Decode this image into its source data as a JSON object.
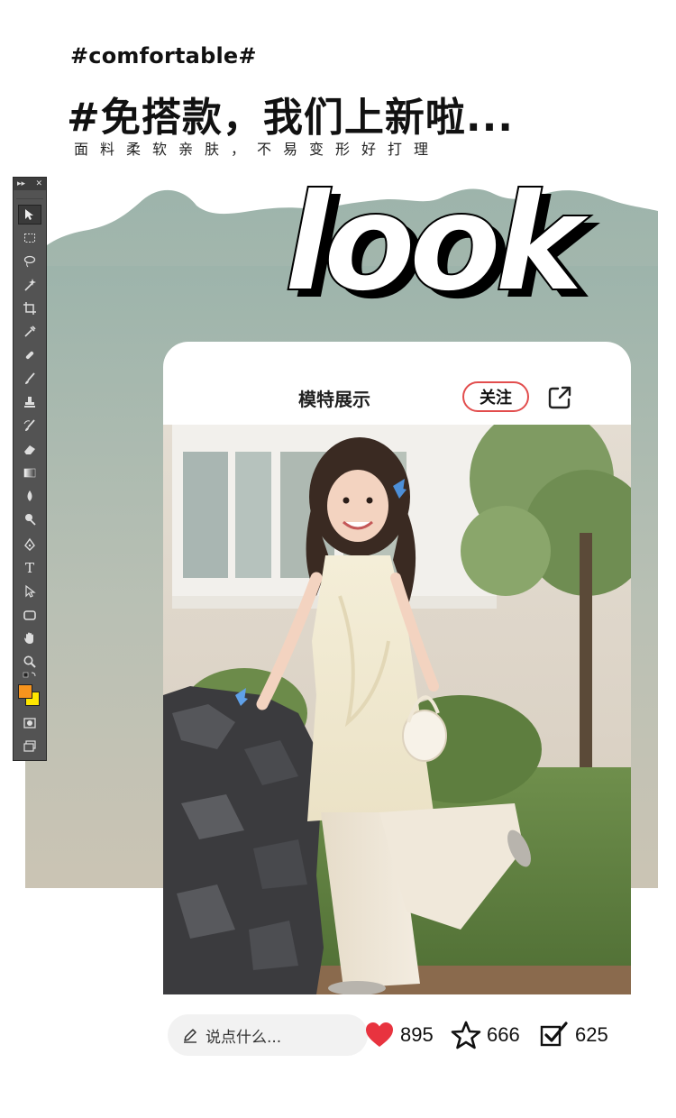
{
  "header": {
    "tag": "#comfortable#",
    "headline": "#免搭款，我们上新啦...",
    "subline": "面料柔软亲肤，不易变形好打理"
  },
  "hero": {
    "word": "look"
  },
  "card": {
    "title": "模特展示",
    "follow_label": "关注",
    "share_icon": "share-icon"
  },
  "bottom_bar": {
    "comment_placeholder": "说点什么...",
    "likes": "895",
    "favorites": "666",
    "shares": "625"
  },
  "colors": {
    "accent_red": "#e24d4d",
    "heart_red": "#e8333f",
    "panel_top": "#9db4ab",
    "panel_bottom": "#c9c3b3",
    "tool_fg": "#f7941d",
    "tool_bg": "#ffe600"
  }
}
